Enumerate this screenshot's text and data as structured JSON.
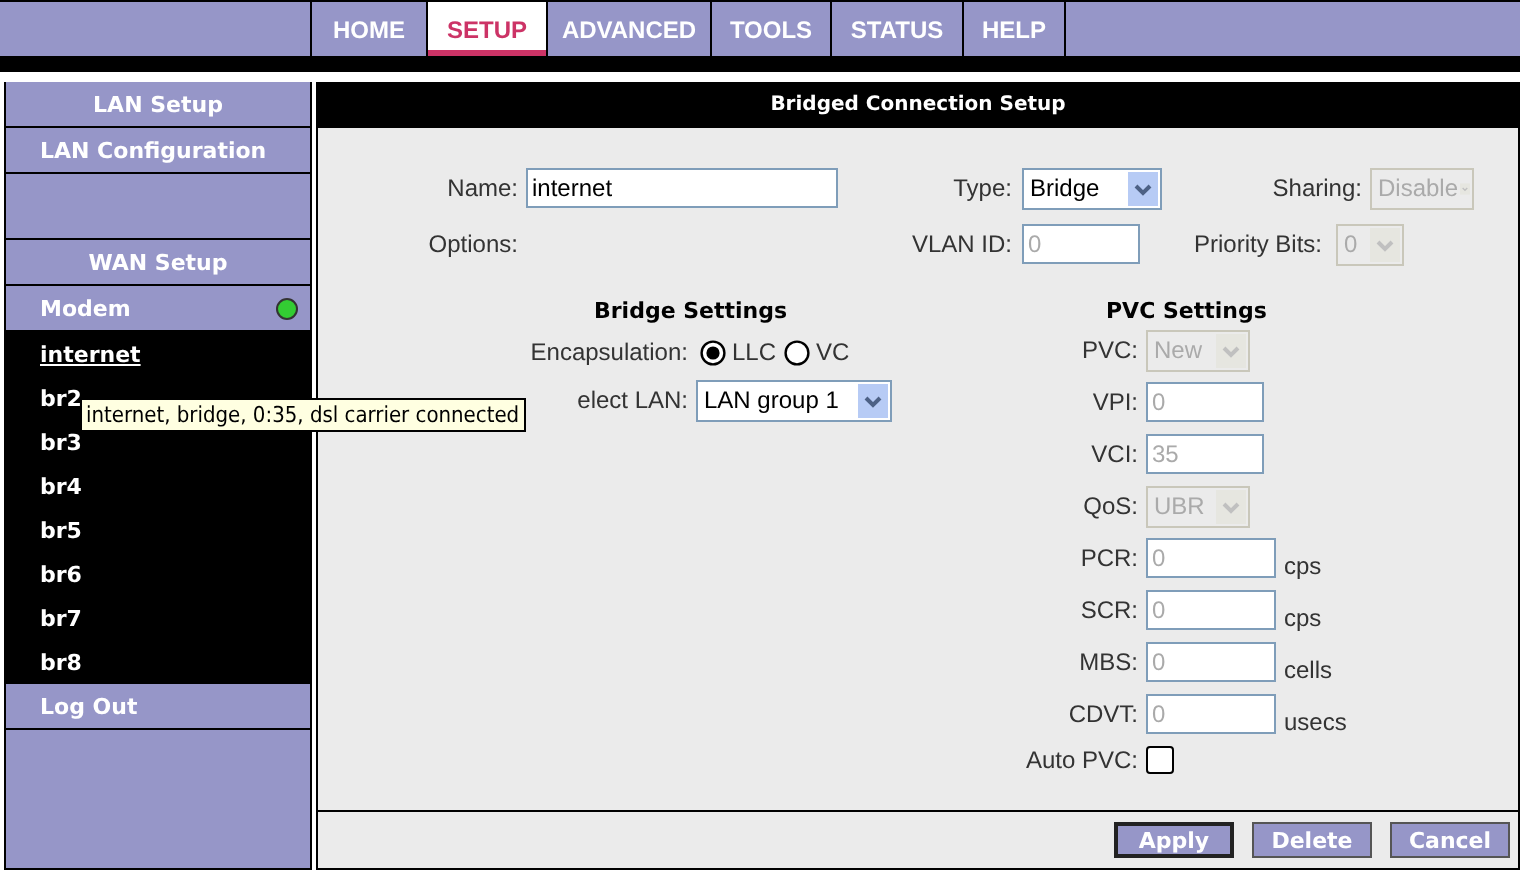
{
  "nav": {
    "tabs": [
      {
        "label": "HOME",
        "selected": false
      },
      {
        "label": "SETUP",
        "selected": true
      },
      {
        "label": "ADVANCED",
        "selected": false
      },
      {
        "label": "TOOLS",
        "selected": false
      },
      {
        "label": "STATUS",
        "selected": false
      },
      {
        "label": "HELP",
        "selected": false
      }
    ]
  },
  "sidebar": {
    "items": [
      {
        "kind": "header",
        "label": "LAN Setup"
      },
      {
        "kind": "link",
        "label": "LAN Configuration"
      },
      {
        "kind": "blank"
      },
      {
        "kind": "header",
        "label": "WAN Setup"
      },
      {
        "kind": "link",
        "label": "Modem",
        "connected": true
      },
      {
        "kind": "sub",
        "label": "internet",
        "selected": true
      },
      {
        "kind": "sub",
        "label": "br2",
        "selected": false
      },
      {
        "kind": "sub",
        "label": "br3",
        "selected": false
      },
      {
        "kind": "sub",
        "label": "br4",
        "selected": false
      },
      {
        "kind": "sub",
        "label": "br5",
        "selected": false
      },
      {
        "kind": "sub",
        "label": "br6",
        "selected": false
      },
      {
        "kind": "sub",
        "label": "br7",
        "selected": false
      },
      {
        "kind": "sub",
        "label": "br8",
        "selected": false
      },
      {
        "kind": "link",
        "label": "Log Out"
      },
      {
        "kind": "filler"
      }
    ]
  },
  "tooltip": {
    "text": "internet, bridge, 0:35, dsl carrier connected"
  },
  "form": {
    "title": "Bridged Connection Setup",
    "name": {
      "label": "Name:",
      "value": "internet",
      "disabled": false
    },
    "type": {
      "label": "Type:",
      "value": "Bridge",
      "disabled": false
    },
    "sharing": {
      "label": "Sharing:",
      "value": "Disable",
      "disabled": true
    },
    "options": {
      "label": "Options:"
    },
    "vlan_id": {
      "label": "VLAN ID:",
      "value": "0",
      "disabled": true
    },
    "priority_bits": {
      "label": "Priority Bits:",
      "value": "0",
      "disabled": true
    },
    "bridge_settings": {
      "title": "Bridge Settings",
      "encapsulation": {
        "label": "Encapsulation:",
        "options": [
          {
            "label": "LLC",
            "selected": true
          },
          {
            "label": "VC",
            "selected": false
          }
        ]
      },
      "select_lan": {
        "label": "elect LAN:",
        "value": "LAN group 1",
        "disabled": false
      }
    },
    "pvc_settings": {
      "title": "PVC Settings",
      "rows": [
        {
          "kind": "select",
          "label": "PVC:",
          "value": "New",
          "disabled": true
        },
        {
          "kind": "input",
          "label": "VPI:",
          "value": "0",
          "disabled": true
        },
        {
          "kind": "input",
          "label": "VCI:",
          "value": "35",
          "disabled": true
        },
        {
          "kind": "select",
          "label": "QoS:",
          "value": "UBR",
          "disabled": true
        },
        {
          "kind": "input",
          "label": "PCR:",
          "value": "0",
          "disabled": true,
          "unit": "cps"
        },
        {
          "kind": "input",
          "label": "SCR:",
          "value": "0",
          "disabled": true,
          "unit": "cps"
        },
        {
          "kind": "input",
          "label": "MBS:",
          "value": "0",
          "disabled": true,
          "unit": "cells"
        },
        {
          "kind": "input",
          "label": "CDVT:",
          "value": "0",
          "disabled": true,
          "unit": "usecs"
        },
        {
          "kind": "checkbox",
          "label": "Auto PVC:",
          "checked": false
        }
      ]
    }
  },
  "buttons": [
    {
      "label": "Apply",
      "default": true
    },
    {
      "label": "Delete",
      "default": false
    },
    {
      "label": "Cancel",
      "default": false
    }
  ]
}
